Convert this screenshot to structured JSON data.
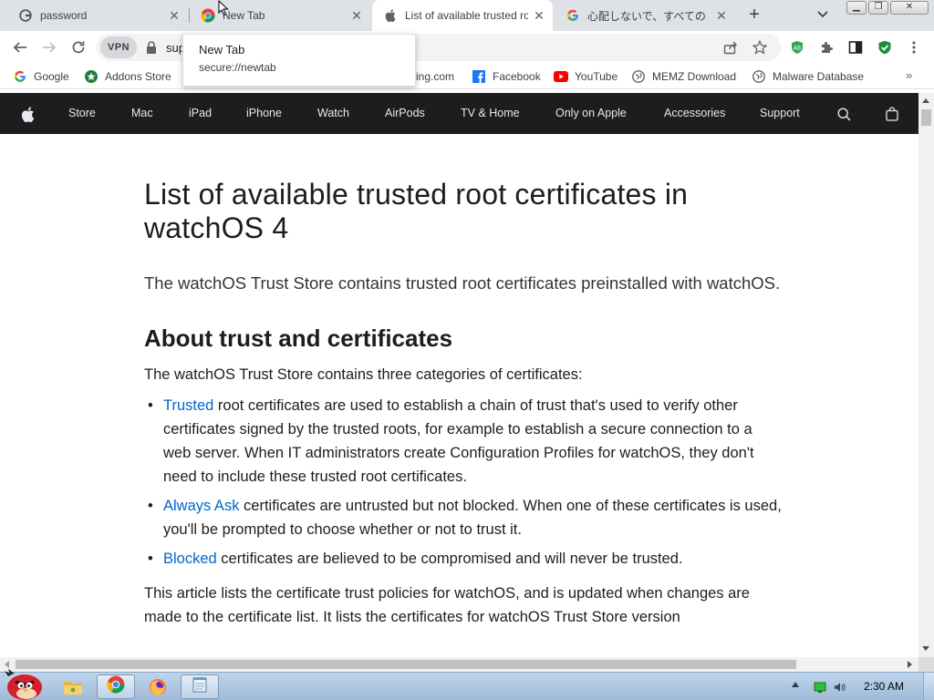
{
  "browser": {
    "tabs": [
      {
        "title": "password",
        "icon": "google-icon",
        "active": false
      },
      {
        "title": "New Tab",
        "icon": "chrome-icon",
        "active": false
      },
      {
        "title": "List of available trusted ro",
        "icon": "apple-icon",
        "active": true
      },
      {
        "title": "心配しないで、すべての",
        "icon": "google-icon",
        "active": false
      }
    ],
    "tooltip": {
      "title": "New Tab",
      "url": "secure://newtab"
    },
    "omnibox": {
      "vpn_label": "VPN",
      "url_text": "sup"
    },
    "bookmarks": [
      {
        "label": "Google",
        "icon": "google-icon"
      },
      {
        "label": "Addons Store",
        "icon": "addons-store-icon"
      },
      {
        "label": "ing.com",
        "icon": "globe-icon"
      },
      {
        "label": "Facebook",
        "icon": "facebook-icon"
      },
      {
        "label": "YouTube",
        "icon": "youtube-icon"
      },
      {
        "label": "MEMZ Download",
        "icon": "globe-icon"
      },
      {
        "label": "Malware Database",
        "icon": "globe-icon"
      }
    ],
    "bookmarks_more": "»"
  },
  "apple_nav": {
    "items": [
      "Store",
      "Mac",
      "iPad",
      "iPhone",
      "Watch",
      "AirPods",
      "TV & Home",
      "Only on Apple",
      "Accessories",
      "Support"
    ]
  },
  "article": {
    "title": "List of available trusted root certificates in watchOS 4",
    "lead": "The watchOS Trust Store contains trusted root certificates preinstalled with watchOS.",
    "section_heading": "About trust and certificates",
    "intro": "The watchOS Trust Store contains three categories of certificates:",
    "bullets": [
      {
        "link": "Trusted",
        "text": " root certificates are used to establish a chain of trust that's used to verify other certificates signed by the trusted roots, for example to establish a secure connection to a web server. When IT administrators create Configuration Profiles for watchOS, they don't need to include these trusted root certificates."
      },
      {
        "link": "Always Ask",
        "text": " certificates are untrusted but not blocked. When one of these certificates is used, you'll be prompted to choose whether or not to trust it."
      },
      {
        "link": "Blocked",
        "text": " certificates are believed to be compromised and will never be trusted."
      }
    ],
    "closing": "This article lists the certificate trust policies for watchOS, and is updated when changes are made to the certificate list. It lists the certificates for watchOS Trust Store version"
  },
  "taskbar": {
    "clock": "2:30 AM",
    "apps": [
      "angry-birds-start-icon",
      "explorer-folder-icon",
      "chrome-icon",
      "firefox-icon",
      "notepad-icon"
    ]
  },
  "colors": {
    "apple_nav_bg": "#1d1d1f",
    "link": "#0066cc",
    "tab_strip": "#dee1e6"
  }
}
